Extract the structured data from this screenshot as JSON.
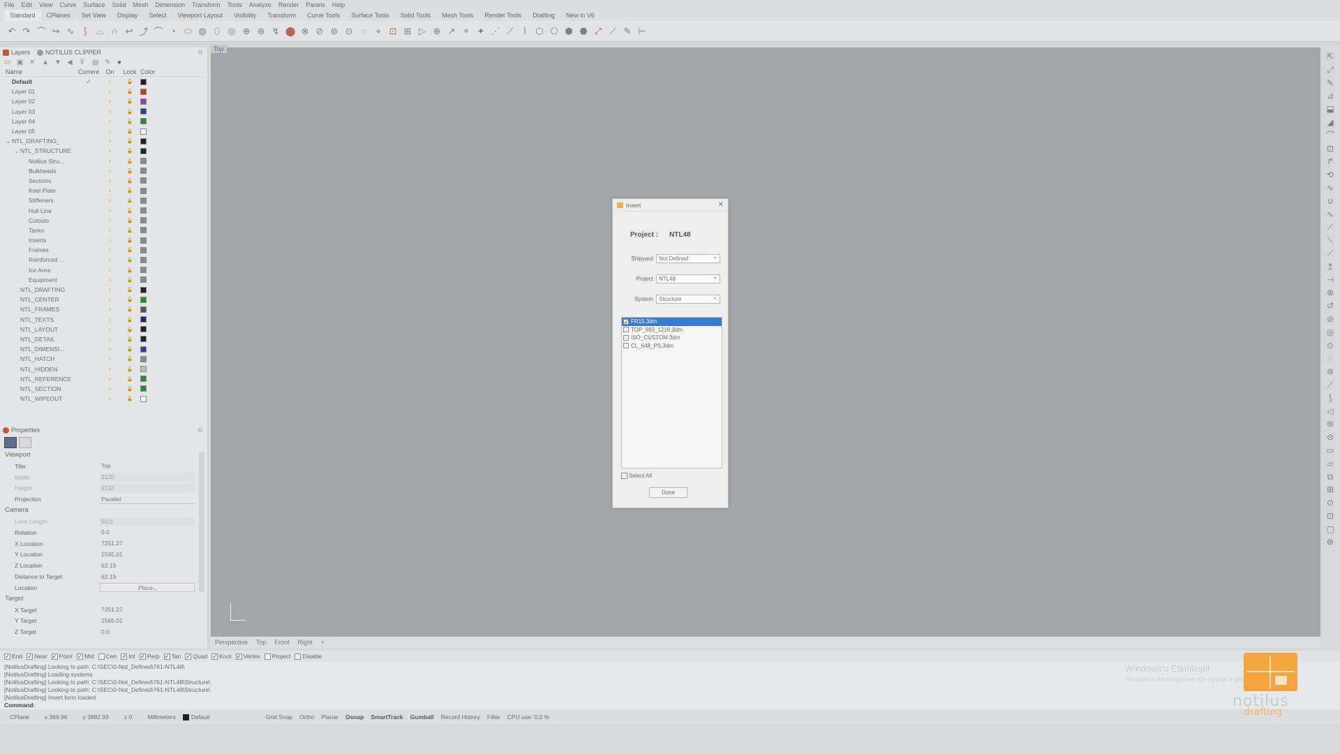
{
  "menu": [
    "File",
    "Edit",
    "View",
    "Curve",
    "Surface",
    "Solid",
    "Mesh",
    "Dimension",
    "Transform",
    "Tools",
    "Analyze",
    "Render",
    "Panels",
    "Help"
  ],
  "tabs": [
    "Standard",
    "CPlanes",
    "Set View",
    "Display",
    "Select",
    "Viewport Layout",
    "Visibility",
    "Transform",
    "Curve Tools",
    "Surface Tools",
    "Solid Tools",
    "Mesh Tools",
    "Render Tools",
    "Drafting",
    "New in V6"
  ],
  "layers_panel": {
    "tab_layers": "Layers",
    "tab_clipper": "NOTILUS CLIPPER",
    "headers": {
      "name": "Name",
      "current": "Current",
      "on": "On",
      "lock": "Lock",
      "color": "Color"
    },
    "rows": [
      {
        "name": "Default",
        "indent": 0,
        "current": "✓",
        "color": "#222222",
        "bold": true
      },
      {
        "name": "Layer 01",
        "indent": 0,
        "current": "",
        "color": "#c0392b"
      },
      {
        "name": "Layer 02",
        "indent": 0,
        "current": "",
        "color": "#8e44ad"
      },
      {
        "name": "Layer 03",
        "indent": 0,
        "current": "",
        "color": "#2c3e8f"
      },
      {
        "name": "Layer 04",
        "indent": 0,
        "current": "",
        "color": "#27893a"
      },
      {
        "name": "Layer 05",
        "indent": 0,
        "current": "",
        "color": "#f2f2f2"
      },
      {
        "name": "NTL_DRAFTING_",
        "indent": 0,
        "current": "",
        "color": "#222222",
        "toggle": "⌄"
      },
      {
        "name": "NTL_STRUCTURE",
        "indent": 1,
        "current": "",
        "color": "#222222",
        "toggle": "⌄"
      },
      {
        "name": "Notilus Stru...",
        "indent": 2,
        "current": "",
        "color": "#8a8a8a"
      },
      {
        "name": "Bulkheads",
        "indent": 2,
        "current": "",
        "color": "#8a8a8a"
      },
      {
        "name": "Sections",
        "indent": 2,
        "current": "",
        "color": "#8a8a8a"
      },
      {
        "name": "Keel Plate",
        "indent": 2,
        "current": "",
        "color": "#8a8a8a"
      },
      {
        "name": "Stiffeners",
        "indent": 2,
        "current": "",
        "color": "#8a8a8a"
      },
      {
        "name": "Hull Line",
        "indent": 2,
        "current": "",
        "color": "#8a8a8a"
      },
      {
        "name": "Cutouts",
        "indent": 2,
        "current": "",
        "color": "#8a8a8a"
      },
      {
        "name": "Tanks",
        "indent": 2,
        "current": "",
        "color": "#8a8a8a"
      },
      {
        "name": "Inserts",
        "indent": 2,
        "current": "",
        "color": "#8a8a8a"
      },
      {
        "name": "Frames",
        "indent": 2,
        "current": "",
        "color": "#8a8a8a"
      },
      {
        "name": "Reinforced ...",
        "indent": 2,
        "current": "",
        "color": "#8a8a8a"
      },
      {
        "name": "Ice Area",
        "indent": 2,
        "current": "",
        "color": "#8a8a8a"
      },
      {
        "name": "Equipment",
        "indent": 2,
        "current": "",
        "color": "#8a8a8a"
      },
      {
        "name": "NTL_DRAFTING",
        "indent": 1,
        "current": "",
        "color": "#222222"
      },
      {
        "name": "NTL_CENTER",
        "indent": 1,
        "current": "",
        "color": "#27893a"
      },
      {
        "name": "NTL_FRAMES",
        "indent": 1,
        "current": "",
        "color": "#555555"
      },
      {
        "name": "NTL_TEXTS",
        "indent": 1,
        "current": "",
        "color": "#1f2a6b"
      },
      {
        "name": "NTL_LAYOUT",
        "indent": 1,
        "current": "",
        "color": "#222222"
      },
      {
        "name": "NTL_DETAIL",
        "indent": 1,
        "current": "",
        "color": "#222222"
      },
      {
        "name": "NTL_DIMENSI...",
        "indent": 1,
        "current": "",
        "color": "#2c3e9f"
      },
      {
        "name": "NTL_HATCH",
        "indent": 1,
        "current": "",
        "color": "#8a8a8a"
      },
      {
        "name": "NTL_HIDDEN",
        "indent": 1,
        "current": "",
        "color": "#bdbdbd"
      },
      {
        "name": "NTL_REFERENCE",
        "indent": 1,
        "current": "",
        "color": "#27893a"
      },
      {
        "name": "NTL_SECTION",
        "indent": 1,
        "current": "",
        "color": "#27893a"
      },
      {
        "name": "NTL_WIPEOUT",
        "indent": 1,
        "current": "",
        "color": "#f2f2f2"
      }
    ]
  },
  "properties": {
    "title": "Properties",
    "viewport_section": "Viewport",
    "camera_section": "Camera",
    "target_section": "Target",
    "viewport_rows": [
      {
        "k": "Title",
        "v": "Top",
        "grey": false
      },
      {
        "k": "Width",
        "v": "2120",
        "grey": true
      },
      {
        "k": "Height",
        "v": "1132",
        "grey": true
      },
      {
        "k": "Projection",
        "v": "Parallel",
        "grey": false,
        "select": true
      }
    ],
    "camera_rows": [
      {
        "k": "Lens Length",
        "v": "50.0",
        "grey": true
      },
      {
        "k": "Rotation",
        "v": "0.0",
        "grey": false
      },
      {
        "k": "X Location",
        "v": "7251.27",
        "grey": false
      },
      {
        "k": "Y Location",
        "v": "1565.01",
        "grey": false
      },
      {
        "k": "Z Location",
        "v": "62.19",
        "grey": false
      },
      {
        "k": "Distance to Target",
        "v": "62.19",
        "grey": false
      },
      {
        "k": "Location",
        "v": "Place...",
        "grey": false,
        "button": true
      }
    ],
    "target_rows": [
      {
        "k": "X Target",
        "v": "7251.27",
        "grey": false
      },
      {
        "k": "Y Target",
        "v": "1565.01",
        "grey": false
      },
      {
        "k": "Z Target",
        "v": "0.0",
        "grey": false
      }
    ]
  },
  "viewport": {
    "label": "Top",
    "tabs": [
      "Perspective",
      "Top",
      "Front",
      "Right"
    ]
  },
  "osnap": [
    {
      "label": "End",
      "checked": true
    },
    {
      "label": "Near",
      "checked": true
    },
    {
      "label": "Point",
      "checked": true
    },
    {
      "label": "Mid",
      "checked": true
    },
    {
      "label": "Cen",
      "checked": false
    },
    {
      "label": "Int",
      "checked": true
    },
    {
      "label": "Perp",
      "checked": true
    },
    {
      "label": "Tan",
      "checked": true
    },
    {
      "label": "Quad",
      "checked": true
    },
    {
      "label": "Knot",
      "checked": true
    },
    {
      "label": "Vertex",
      "checked": true
    },
    {
      "label": "Project",
      "checked": false
    },
    {
      "label": "Disable",
      "checked": false
    }
  ],
  "command_lines": [
    "[NotilusDrafting] Looking to path: C:\\SEC\\0-Not_Defined\\761-NTL48\\",
    "[NotilusDrafting] Loading systems",
    "[NotilusDrafting] Looking to path: C:\\SEC\\0-Not_Defined\\761-NTL48\\Structure\\",
    "[NotilusDrafting] Looking to path: C:\\SEC\\0-Not_Defined\\761-NTL48\\Structure\\",
    "[NotilusDrafting] Insert form loaded"
  ],
  "command_prompt": "Command:",
  "status": {
    "cplane": "CPlane",
    "x": "x 369.96",
    "y": "y 3882.93",
    "z": "z 0",
    "units": "Millimeters",
    "layer": "Default",
    "toggles": [
      "Grid Snap",
      "Ortho",
      "Planar",
      "Osnap",
      "SmartTrack",
      "Gumball",
      "Record History",
      "Filter"
    ],
    "bold_toggles": [
      "Osnap",
      "SmartTrack",
      "Gumball"
    ],
    "cpu": "CPU use: 0.0 %"
  },
  "dialog": {
    "title": "Insert",
    "project_label": "Project :",
    "project_value": "NTL48",
    "shipyard_label": "Shipyard",
    "shipyard_value": "Not Defined",
    "project_field_label": "Project",
    "project_field_value": "NTL48",
    "system_label": "System",
    "system_value": "Structure",
    "files": [
      {
        "name": "FR15.3dm",
        "checked": true,
        "selected": true
      },
      {
        "name": "TOP_993_1216.3dm",
        "checked": false,
        "selected": false
      },
      {
        "name": "ISO_CUSTOM.3dm",
        "checked": false,
        "selected": false
      },
      {
        "name": "CL_648_PS.3dm",
        "checked": false,
        "selected": false
      }
    ],
    "select_all_label": "Select All",
    "done_label": "Done"
  },
  "watermark": {
    "line1": "Windows'u Etkinleştir",
    "line2": "Windows'u etkinleştirmek için Ayarlar'a gidin."
  },
  "brand": {
    "line1": "notilus",
    "line2": "drafting"
  }
}
